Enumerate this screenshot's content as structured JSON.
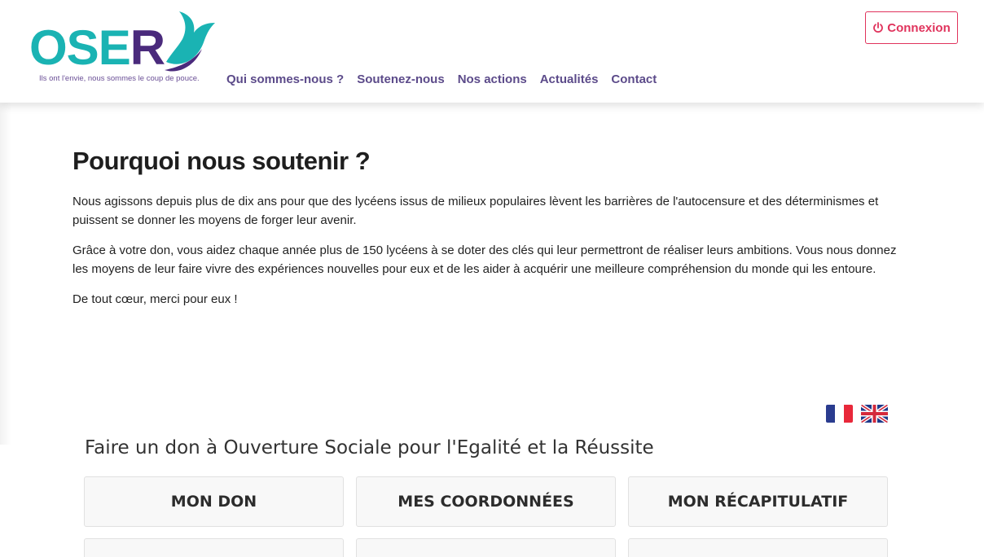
{
  "header": {
    "logo": {
      "text_teal": "OSE",
      "text_purple": "R",
      "tagline": "Ils ont l'envie, nous sommes le coup de pouce."
    },
    "nav": [
      "Qui sommes-nous ?",
      "Soutenez-nous",
      "Nos actions",
      "Actualités",
      "Contact"
    ],
    "login_label": "Connexion",
    "login_icon": "power-icon"
  },
  "content": {
    "title": "Pourquoi nous soutenir ?",
    "paragraphs": [
      "Nous agissons depuis plus de dix ans pour que des lycéens issus de milieux populaires lèvent les barrières de l'autocensure et des déterminismes et puissent se donner les moyens de forger leur avenir.",
      "Grâce à votre don, vous aidez chaque année plus de 150 lycéens à se doter des clés qui leur permettront de réaliser leurs ambitions. Vous nous donnez les moyens de leur faire vivre des expériences nouvelles pour eux et de les aider à acquérir une meilleure compréhension du monde qui les entoure.",
      "De tout cœur, merci pour eux !"
    ]
  },
  "languages": [
    "french-flag-icon",
    "uk-flag-icon"
  ],
  "donation": {
    "title": "Faire un don à Ouverture Sociale pour l'Egalité et la Réussite",
    "steps": [
      "MON DON",
      "MES COORDONNÉES",
      "MON RÉCAPITULATIF"
    ]
  },
  "colors": {
    "teal": "#1ab3b3",
    "purple": "#4a2a7c",
    "nav": "#5c4b8a",
    "accent": "#e0335c"
  }
}
